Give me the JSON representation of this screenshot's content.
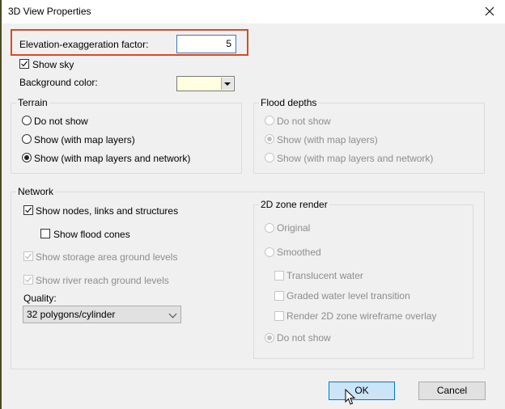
{
  "window": {
    "title": "3D View Properties",
    "close_icon": "close-x-icon"
  },
  "elevation": {
    "label": "Elevation-exaggeration factor:",
    "value": "5",
    "highlight_color": "#d84a25"
  },
  "show_sky": {
    "label": "Show sky",
    "checked": true
  },
  "background_color": {
    "label": "Background color:",
    "value": "#fffee0"
  },
  "terrain": {
    "legend": "Terrain",
    "options": [
      {
        "label": "Do not show",
        "selected": false
      },
      {
        "label": "Show (with map layers)",
        "selected": false
      },
      {
        "label": "Show (with map layers and network)",
        "selected": true
      }
    ]
  },
  "flood_depths": {
    "legend": "Flood depths",
    "disabled": true,
    "options": [
      {
        "label": "Do not show",
        "selected": false
      },
      {
        "label": "Show (with map layers)",
        "selected": true
      },
      {
        "label": "Show (with map layers and network)",
        "selected": false
      }
    ]
  },
  "network": {
    "legend": "Network",
    "show_nodes": {
      "label": "Show nodes, links and structures",
      "checked": true
    },
    "show_flood_cones": {
      "label": "Show flood cones",
      "checked": false
    },
    "show_storage": {
      "label": "Show storage area ground levels",
      "checked": true,
      "disabled": true
    },
    "show_river": {
      "label": "Show river reach ground levels",
      "checked": true,
      "disabled": true
    },
    "quality_label": "Quality:",
    "quality_value": "32 polygons/cylinder"
  },
  "zone_render": {
    "legend": "2D zone render",
    "disabled": true,
    "original": {
      "label": "Original",
      "selected": false
    },
    "smoothed": {
      "label": "Smoothed",
      "selected": false
    },
    "translucent": {
      "label": "Translucent water",
      "checked": false
    },
    "graded": {
      "label": "Graded water level transition",
      "checked": false
    },
    "wireframe": {
      "label": "Render 2D zone wireframe overlay",
      "checked": false
    },
    "do_not_show": {
      "label": "Do not show",
      "selected": true
    }
  },
  "buttons": {
    "ok": "OK",
    "cancel": "Cancel"
  }
}
